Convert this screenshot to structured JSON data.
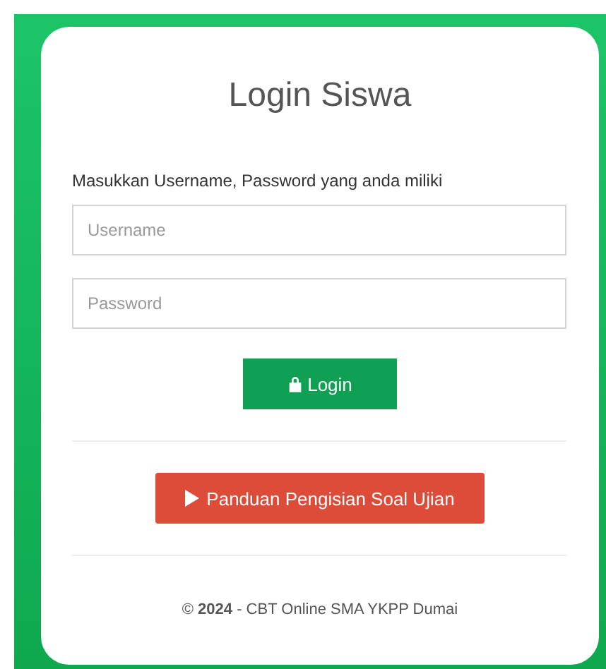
{
  "title": "Login Siswa",
  "instruction": "Masukkan Username, Password yang anda miliki",
  "fields": [
    {
      "placeholder": "Username"
    },
    {
      "placeholder": "Password"
    }
  ],
  "login_button": "Login",
  "guide_button": "Panduan Pengisian Soal Ujian",
  "footer": "© **2024** - CBT Online SMA YKPP Dumai"
}
